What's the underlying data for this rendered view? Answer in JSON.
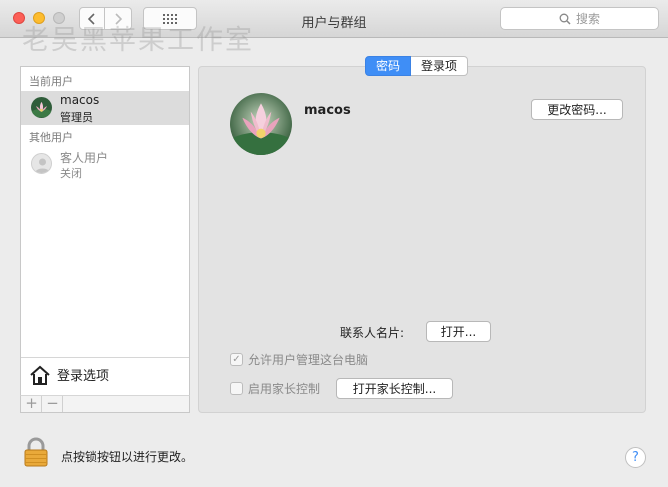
{
  "window": {
    "title": "用户与群组",
    "search_placeholder": "搜索"
  },
  "watermark": "老吴黑苹果工作室",
  "sidebar": {
    "current_header": "当前用户",
    "current_user": {
      "name": "macos",
      "role": "管理员"
    },
    "other_header": "其他用户",
    "guest_user": {
      "name": "客人用户",
      "role": "关闭"
    },
    "login_options": "登录选项",
    "add_label": "+",
    "remove_label": "−"
  },
  "tabs": {
    "password": "密码",
    "login_items": "登录项"
  },
  "main": {
    "user_name": "macos",
    "change_password": "更改密码...",
    "contact_card_label": "联系人名片:",
    "open_button": "打开...",
    "allow_admin_label": "允许用户管理这台电脑",
    "allow_admin_checked": true,
    "parental_label": "启用家长控制",
    "parental_checked": false,
    "open_parental": "打开家长控制..."
  },
  "footer": {
    "lock_text": "点按锁按钮以进行更改。",
    "help": "?"
  },
  "colors": {
    "accent": "#3f8ef6",
    "close": "#fc5f57",
    "minimize": "#fdbc2e"
  }
}
